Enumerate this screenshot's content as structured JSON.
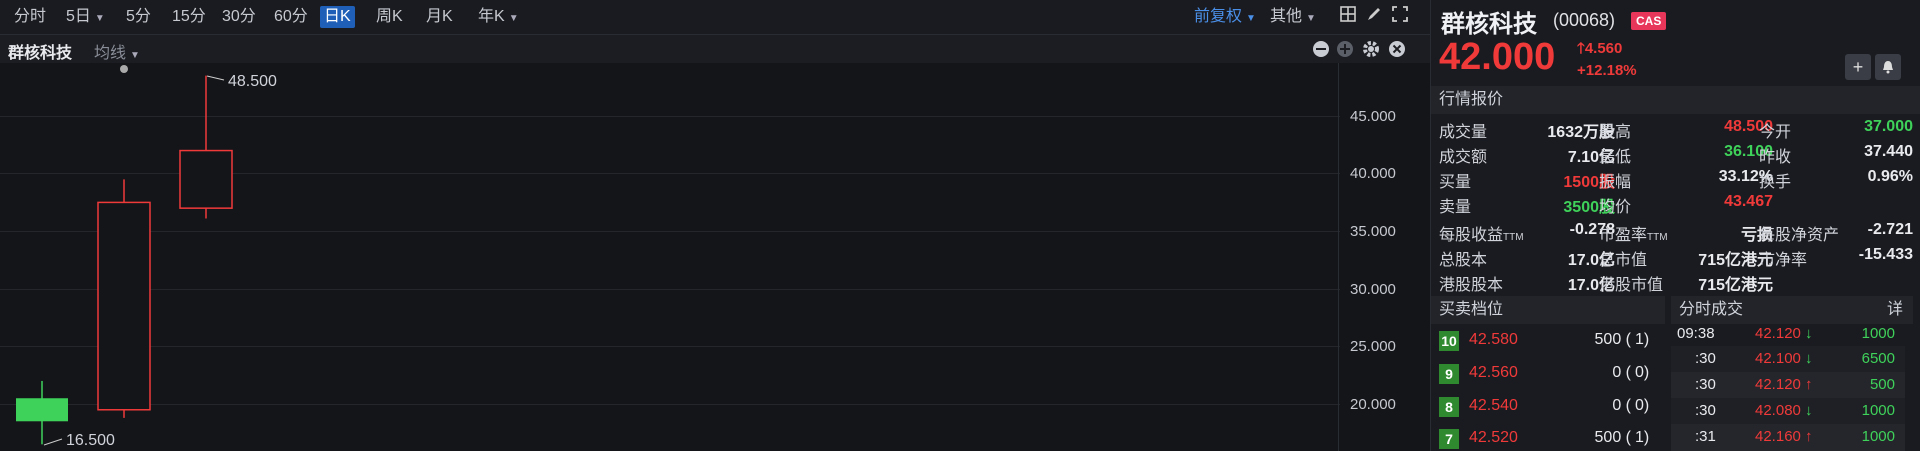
{
  "toolbar": {
    "tabs": [
      "分时",
      "5日",
      "5分",
      "15分",
      "30分",
      "60分",
      "日K",
      "周K",
      "月K",
      "年K"
    ],
    "active_tab": "日K",
    "fq": "前复权",
    "other": "其他"
  },
  "chart": {
    "name": "群核科技",
    "ma": "均线",
    "high_marker": "48.500",
    "low_marker": "16.500",
    "yticks": [
      "45.000",
      "40.000",
      "35.000",
      "30.000",
      "25.000",
      "20.000"
    ]
  },
  "chart_data": {
    "type": "candlestick",
    "ylim": [
      17,
      50
    ],
    "yticks": [
      45,
      40,
      35,
      30,
      25,
      20
    ],
    "candles": [
      {
        "open": 18.5,
        "close": 20.5,
        "high": 22.0,
        "low": 16.5,
        "color": "#3fd25a"
      },
      {
        "open": 19.5,
        "close": 37.5,
        "high": 39.5,
        "low": 18.8,
        "color": "#f03a3a"
      },
      {
        "open": 37.0,
        "close": 42.0,
        "high": 48.5,
        "low": 36.1,
        "color": "#f03a3a"
      }
    ],
    "annotations": [
      "48.500",
      "16.500"
    ]
  },
  "stock": {
    "name": "群核科技",
    "code": "(00068)",
    "badge": "CAS",
    "price": "42.000",
    "change": "4.560",
    "change_pct": "+12.18%"
  },
  "quote": {
    "title": "行情报价",
    "rows": [
      [
        "成交量",
        "1632万股",
        "最高",
        "48.500",
        "今开",
        "37.000"
      ],
      [
        "成交额",
        "7.10亿",
        "最低",
        "36.100",
        "昨收",
        "37.440"
      ],
      [
        "买量",
        "1500股",
        "振幅",
        "33.12%",
        "换手",
        "0.96%"
      ],
      [
        "卖量",
        "3500股",
        "均价",
        "43.467",
        "",
        ""
      ]
    ],
    "rows2": [
      [
        "每股收益",
        "-0.278",
        "市盈率",
        "亏损",
        "每股净资产",
        "-2.721"
      ],
      [
        "总股本",
        "17.0亿",
        "总市值",
        "715亿港元",
        "市净率",
        "-15.433"
      ],
      [
        "港股股本",
        "17.0亿",
        "港股市值",
        "715亿港元",
        "",
        ""
      ]
    ],
    "ttm": "TTM"
  },
  "depth": {
    "title": "买卖档位",
    "rows": [
      {
        "lvl": "10",
        "price": "42.580",
        "vol": "500 (",
        "cnt": "1)"
      },
      {
        "lvl": "9",
        "price": "42.560",
        "vol": "0 (",
        "cnt": "0)"
      },
      {
        "lvl": "8",
        "price": "42.540",
        "vol": "0 (",
        "cnt": "0)"
      },
      {
        "lvl": "7",
        "price": "42.520",
        "vol": "500 (",
        "cnt": "1)"
      }
    ]
  },
  "ticks": {
    "title": "分时成交",
    "detail": "详",
    "rows": [
      {
        "time": "09:38",
        "price": "42.120",
        "dir": "↓",
        "vol": "1000"
      },
      {
        "time": ":30",
        "price": "42.100",
        "dir": "↓",
        "vol": "6500"
      },
      {
        "time": ":30",
        "price": "42.120",
        "dir": "↑",
        "vol": "500"
      },
      {
        "time": ":30",
        "price": "42.080",
        "dir": "↓",
        "vol": "1000"
      },
      {
        "time": ":31",
        "price": "42.160",
        "dir": "↑",
        "vol": "1000"
      }
    ]
  }
}
